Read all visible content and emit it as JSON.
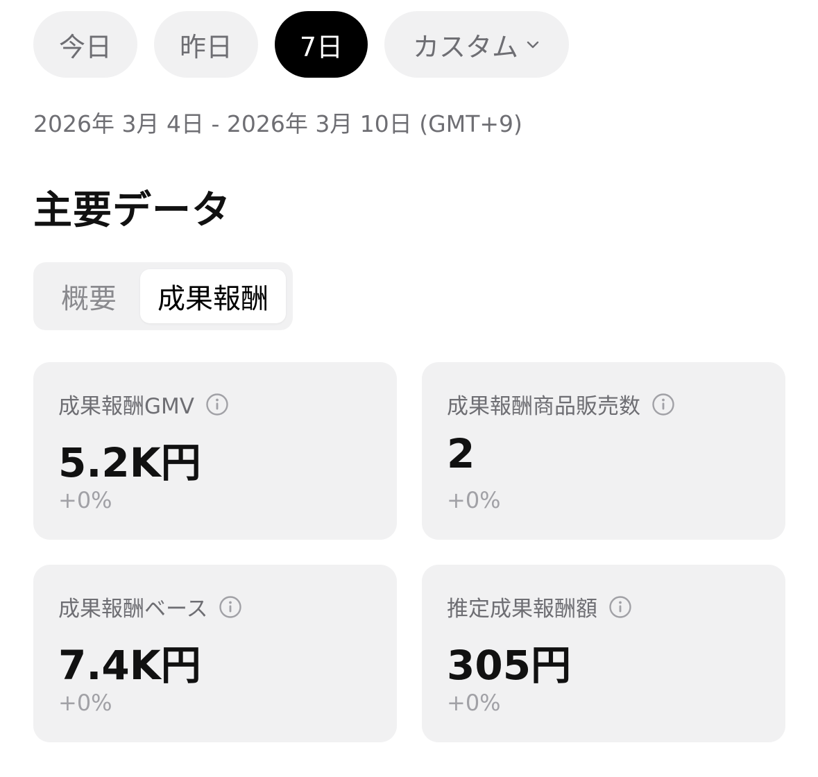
{
  "date_filter": {
    "today": "今日",
    "yesterday": "昨日",
    "seven_days": "7日",
    "custom": "カスタム",
    "selected": "7日"
  },
  "date_range": "2026年 3月 4日 - 2026年 3月 10日 (GMT+9)",
  "section_title": "主要データ",
  "segment_tabs": {
    "overview": "概要",
    "affiliate": "成果報酬",
    "selected": "成果報酬"
  },
  "metrics": [
    {
      "label": "成果報酬GMV",
      "value": "5.2K円",
      "change": "+0%"
    },
    {
      "label": "成果報酬商品販売数",
      "value": "2",
      "change": "+0%"
    },
    {
      "label": "成果報酬ベース",
      "value": "7.4K円",
      "change": "+0%"
    },
    {
      "label": "推定成果報酬額",
      "value": "305円",
      "change": "+0%"
    }
  ],
  "icons": {
    "dropdown": "chevron-down-icon",
    "info": "info-icon"
  },
  "colors": {
    "active_chip": "#000000",
    "chip_bg": "#f1f1f2",
    "card_bg": "#f1f1f2",
    "muted_text": "#6e6e73",
    "change_text": "#a1a1a6"
  }
}
